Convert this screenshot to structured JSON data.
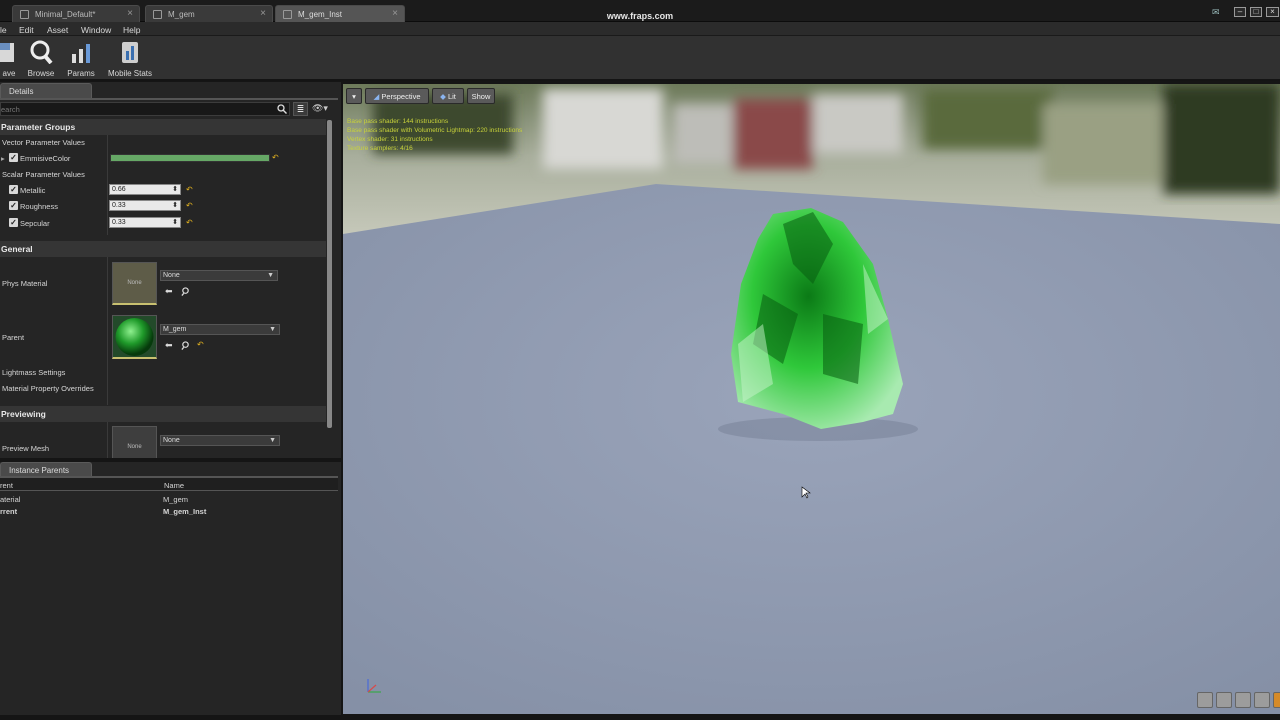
{
  "titlebar": {
    "tabs": [
      {
        "label": "Minimal_Default*"
      },
      {
        "label": "M_gem"
      },
      {
        "label": "M_gem_Inst"
      }
    ],
    "center_text": "www.fraps.com"
  },
  "menu": {
    "items": [
      "le",
      "Edit",
      "Asset",
      "Window",
      "Help"
    ]
  },
  "toolbar": {
    "buttons": [
      {
        "label": "ave",
        "icon": "save-icon"
      },
      {
        "label": "Browse",
        "icon": "browse-icon"
      },
      {
        "label": "Params",
        "icon": "params-icon"
      },
      {
        "label": "Mobile Stats",
        "icon": "mobile-stats-icon"
      }
    ]
  },
  "details": {
    "tab_label": "Details",
    "search_placeholder": "earch",
    "parameter_groups": {
      "title": "Parameter Groups",
      "vector_label": "Vector Parameter Values",
      "emissive_label": "EmmisiveColor",
      "emissive_color": "#66a866",
      "scalar_label": "Scalar Parameter Values",
      "scalars": [
        {
          "label": "Metallic",
          "value": "0.66"
        },
        {
          "label": "Roughness",
          "value": "0.33"
        },
        {
          "label": "Sepcular",
          "value": "0.33"
        }
      ]
    },
    "general": {
      "title": "General",
      "phys_material_label": "Phys Material",
      "phys_material_thumb": "None",
      "phys_material_value": "None",
      "parent_label": "Parent",
      "parent_value": "M_gem",
      "lightmass_label": "Lightmass Settings",
      "overrides_label": "Material Property Overrides"
    },
    "previewing": {
      "title": "Previewing",
      "preview_mesh_label": "Preview Mesh",
      "preview_mesh_thumb": "None",
      "preview_mesh_value": "None"
    }
  },
  "instance_parents": {
    "tab_label": "Instance Parents",
    "columns": [
      "rent",
      "Name"
    ],
    "rows": [
      {
        "col1": "aterial",
        "col2": "M_gem"
      },
      {
        "col1": "rrent",
        "col2": "M_gem_Inst"
      }
    ]
  },
  "viewport": {
    "buttons": {
      "perspective": "Perspective",
      "lit": "Lit",
      "show": "Show"
    },
    "stats": [
      "Base pass shader: 144 instructions",
      "Base pass shader with Volumetric Lightmap: 220 instructions",
      "Vertex shader: 31 instructions",
      "Texture samplers: 4/16"
    ],
    "colors": {
      "accent": "#e0b020",
      "gem": "#2fc83a",
      "floor": "#8d97ad"
    }
  }
}
